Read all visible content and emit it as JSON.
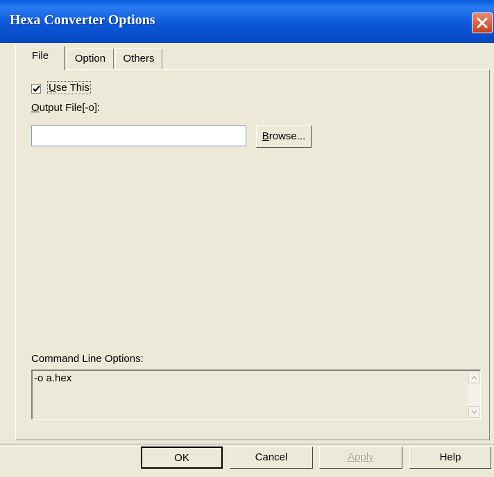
{
  "window": {
    "title": "Hexa Converter Options",
    "close_icon": "close-icon"
  },
  "tabs": [
    {
      "label": "File",
      "active": true
    },
    {
      "label": "Option",
      "active": false
    },
    {
      "label": "Others",
      "active": false
    }
  ],
  "file_tab": {
    "use_this": {
      "label_mnemonic": "U",
      "label_rest": "se This",
      "checked": true
    },
    "output_file": {
      "label_mnemonic": "O",
      "label_rest": "utput File[-o]:",
      "value": ""
    },
    "browse": {
      "label_mnemonic": "B",
      "label_rest": "rowse..."
    },
    "command_line": {
      "label": "Command Line Options:",
      "value": "-o a.hex"
    }
  },
  "buttons": {
    "ok": "OK",
    "cancel": "Cancel",
    "apply": "Apply",
    "apply_enabled": false,
    "help": "Help"
  },
  "colors": {
    "titlebar": "#0A5FE0",
    "face": "#ECE9D8",
    "close": "#C8401E"
  }
}
